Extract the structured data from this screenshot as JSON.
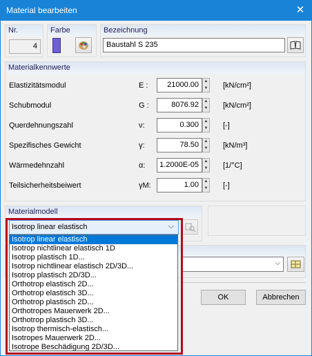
{
  "window": {
    "title": "Material bearbeiten"
  },
  "header": {
    "nr_label": "Nr.",
    "nr_value": "4",
    "farbe_label": "Farbe",
    "color_swatch": "#6f5fd0",
    "bezeichnung_label": "Bezeichnung",
    "bezeichnung_value": "Baustahl S 235"
  },
  "kennwerte": {
    "heading": "Materialkennwerte",
    "rows": [
      {
        "label": "Elastizitätsmodul",
        "symbol": "E :",
        "value": "21000.00",
        "unit": "[kN/cm²]"
      },
      {
        "label": "Schubmodul",
        "symbol": "G :",
        "value": "8076.92",
        "unit": "[kN/cm²]"
      },
      {
        "label": "Querdehnungszahl",
        "symbol": "ν:",
        "value": "0.300",
        "unit": "[-]"
      },
      {
        "label": "Spezifisches Gewicht",
        "symbol": "γ:",
        "value": "78.50",
        "unit": "[kN/m³]"
      },
      {
        "label": "Wärmedehnzahl",
        "symbol": "α:",
        "value": "1.2000E-05",
        "unit": "[1/°C]"
      },
      {
        "label": "Teilsicherheitsbeiwert",
        "symbol": "γM:",
        "value": "1.00",
        "unit": "[-]"
      }
    ]
  },
  "materialmodell": {
    "heading": "Materialmodell",
    "selected": "Isotrop linear elastisch",
    "options": [
      "Isotrop linear elastisch",
      "Isotrop nichtlinear elastisch 1D",
      "Isotrop plastisch 1D...",
      "Isotrop nichtlinear elastisch 2D/3D...",
      "Isotrop plastisch 2D/3D...",
      "Orthotrop elastisch 2D...",
      "Orthotrop elastisch 3D...",
      "Orthotrop plastisch 2D...",
      "Orthotropes Mauerwerk 2D...",
      "Orthotrop plastisch 3D...",
      "Isotrop thermisch-elastisch...",
      "Isotropes Mauerwerk 2D...",
      "Isotrope Beschädigung 2D/3D..."
    ]
  },
  "buttons": {
    "ok": "OK",
    "cancel": "Abbrechen"
  },
  "colors": {
    "titlebar": "#1883d7",
    "highlight": "#0078d7",
    "frame": "#b40a1e"
  }
}
